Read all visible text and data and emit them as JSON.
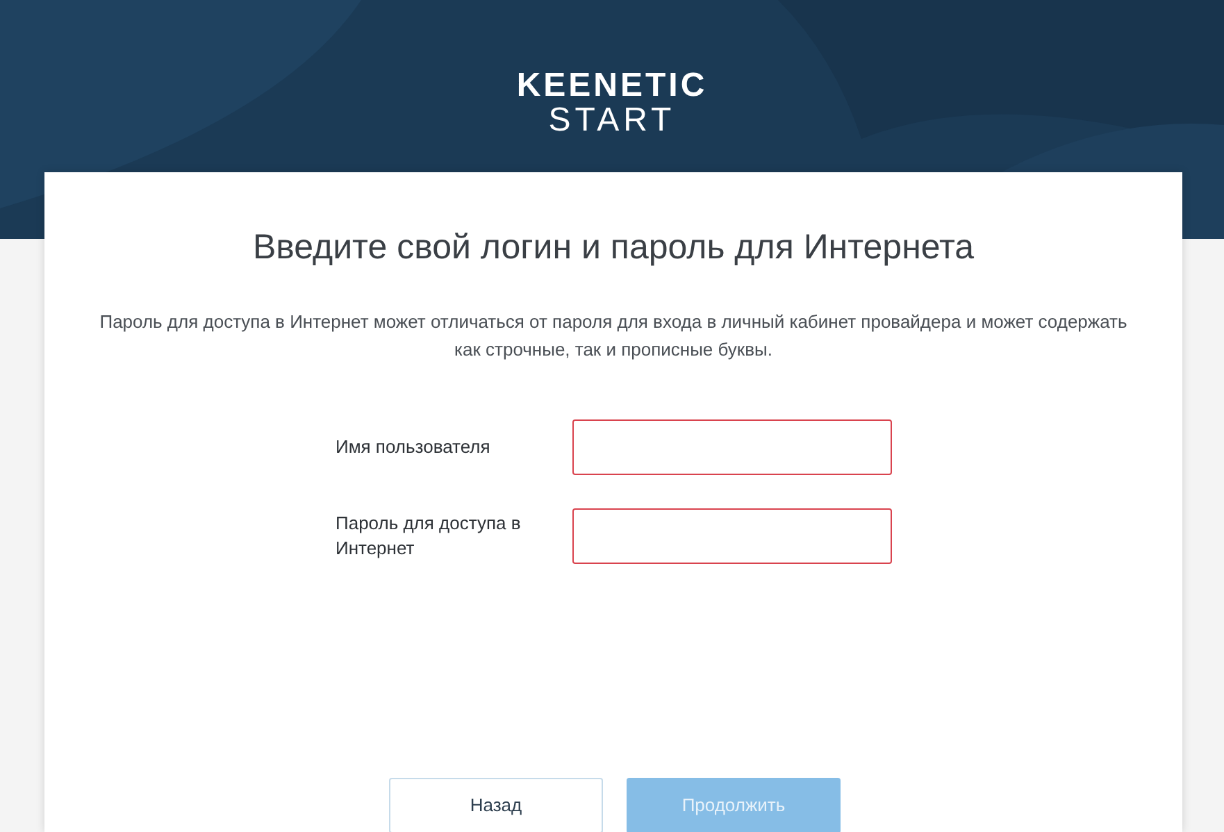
{
  "logo": {
    "brand": "KEENETIC",
    "product": "START"
  },
  "title": "Введите свой логин и пароль для Интернета",
  "description": "Пароль для доступа в Интернет может отличаться от пароля для входа в личный кабинет провайдера и может содержать как строчные, так и прописные буквы.",
  "fields": [
    {
      "label": "Имя пользователя",
      "invalid": true
    },
    {
      "label": "Пароль для доступа в Интернет",
      "invalid": true
    }
  ],
  "buttons": [
    {
      "label": "Назад",
      "kind": "secondary",
      "disabled": false
    },
    {
      "label": "Продолжить",
      "kind": "primary",
      "disabled": true
    }
  ]
}
